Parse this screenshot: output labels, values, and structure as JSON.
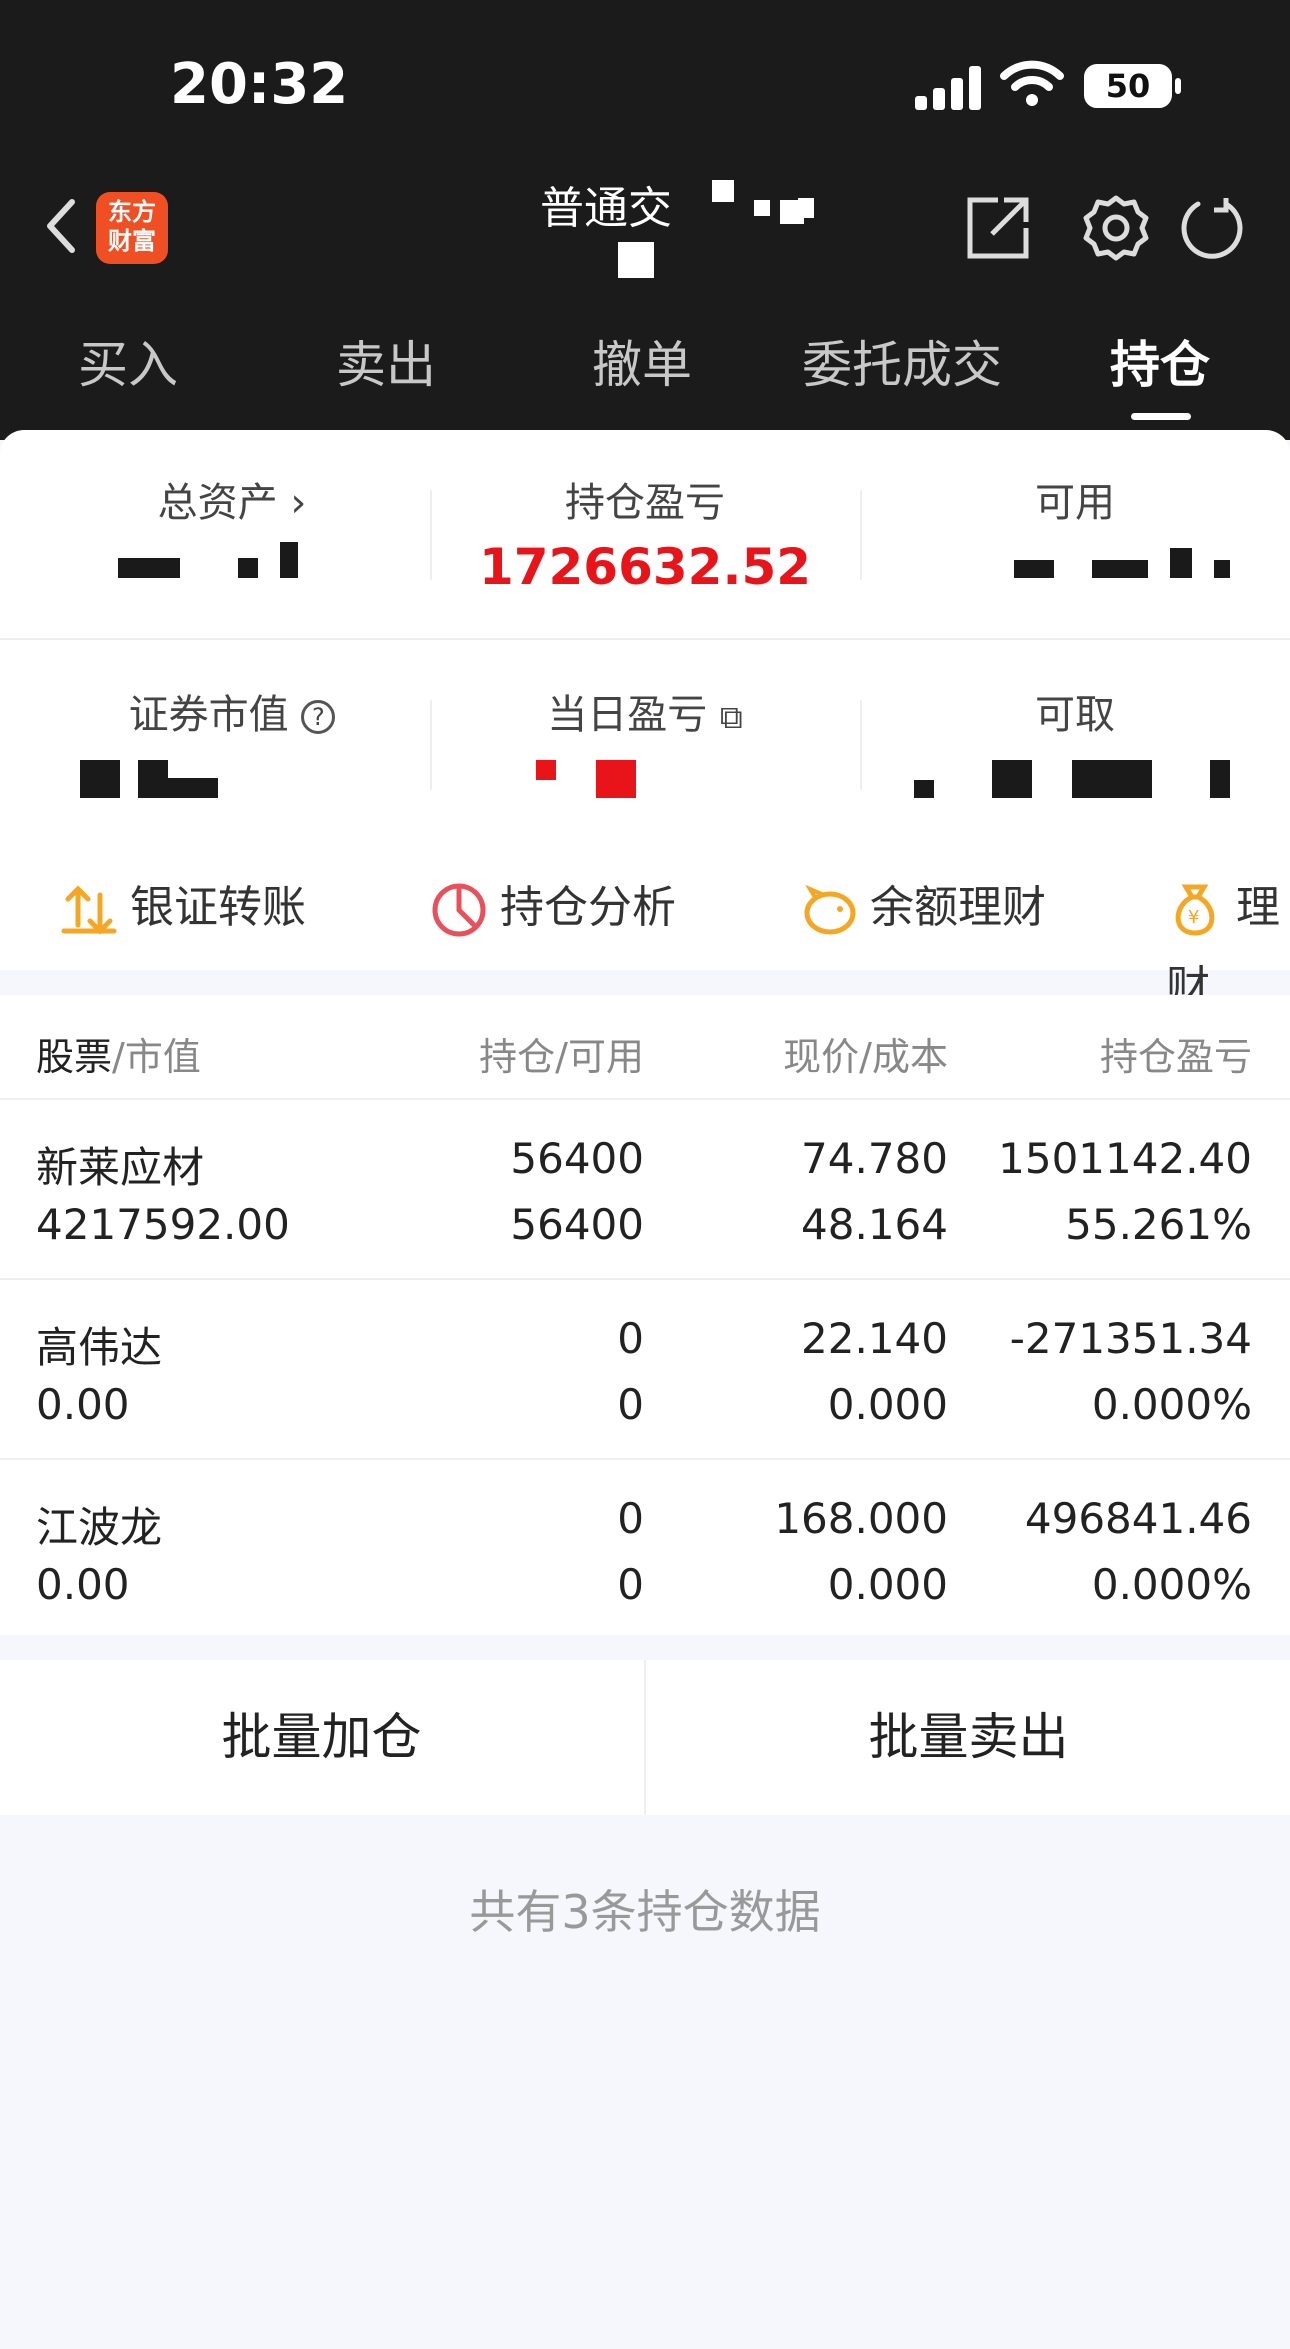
{
  "status_bar": {
    "time": "20:32",
    "battery": "50"
  },
  "header": {
    "logo_text": "东方财富",
    "title": "普通交"
  },
  "tabs": [
    {
      "label": "买入"
    },
    {
      "label": "卖出"
    },
    {
      "label": "撤单"
    },
    {
      "label": "委托成交"
    },
    {
      "label": "持仓",
      "active": true
    }
  ],
  "summary": {
    "total_assets": {
      "label": "总资产"
    },
    "position_pl": {
      "label": "持仓盈亏",
      "value": "1726632.52"
    },
    "available": {
      "label": "可用"
    },
    "market_value": {
      "label": "证券市值"
    },
    "daily_pl": {
      "label": "当日盈亏"
    },
    "withdrawable": {
      "label": "可取"
    }
  },
  "tools": [
    {
      "label": "银证转账",
      "icon": "transfer-icon"
    },
    {
      "label": "持仓分析",
      "icon": "pie-chart-icon"
    },
    {
      "label": "余额理财",
      "icon": "piggy-bank-icon"
    },
    {
      "label": "理财",
      "icon": "money-bag-icon"
    }
  ],
  "table": {
    "headers": {
      "stock": "股票",
      "stock_sub": "市值",
      "hold": "持仓",
      "hold_sub": "可用",
      "price": "现价",
      "price_sub": "成本",
      "pl": "持仓盈亏"
    },
    "rows": [
      {
        "name": "新莱应材",
        "market_value": "4217592.00",
        "holding": "56400",
        "available": "56400",
        "price": "74.780",
        "cost": "48.164",
        "pl": "1501142.40",
        "pl_pct": "55.261%",
        "pl_color": "red",
        "pct_color": "red"
      },
      {
        "name": "高伟达",
        "market_value": "0.00",
        "holding": "0",
        "available": "0",
        "price": "22.140",
        "cost": "0.000",
        "pl": "-271351.34",
        "pl_pct": "0.000%",
        "pl_color": "green",
        "pct_color": "green"
      },
      {
        "name": "江波龙",
        "market_value": "0.00",
        "holding": "0",
        "available": "0",
        "price": "168.000",
        "cost": "0.000",
        "pl": "496841.46",
        "pl_pct": "0.000%",
        "pl_color": "red",
        "pct_color": "red"
      }
    ]
  },
  "actions": {
    "batch_add": "批量加仓",
    "batch_sell": "批量卖出"
  },
  "footer": {
    "summary": "共有3条持仓数据"
  },
  "colors": {
    "up": "#e8141a",
    "down": "#3a9a2a",
    "header_bg": "#1b1b1b",
    "brand": "#f04e23",
    "accent": "#f5a623"
  }
}
